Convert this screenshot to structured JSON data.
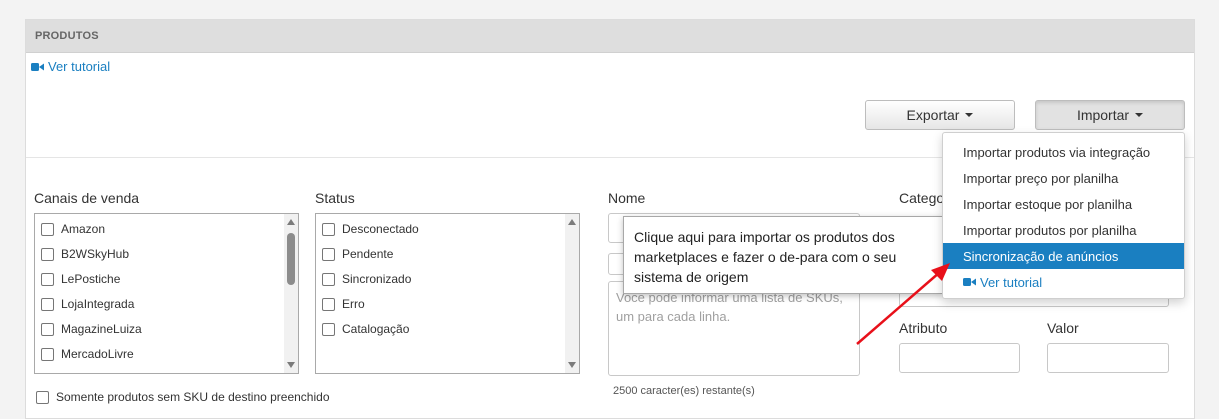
{
  "panel": {
    "title": "PRODUTOS"
  },
  "tutorial": {
    "label": "Ver tutorial"
  },
  "toolbar": {
    "export_label": "Exportar",
    "import_label": "Importar"
  },
  "filters": {
    "channels_label": "Canais de venda",
    "channels": [
      "Amazon",
      "B2WSkyHub",
      "LePostiche",
      "LojaIntegrada",
      "MagazineLuiza",
      "MercadoLivre"
    ],
    "status_label": "Status",
    "statuses": [
      "Desconectado",
      "Pendente",
      "Sincronizado",
      "Erro",
      "Catalogação"
    ],
    "name_label": "Nome",
    "category_label": "Catego",
    "sku_placeholder": "Voce pode informar uma lista de SKUs, um para cada linha.",
    "chars_remaining": "2500 caracter(es) restante(s)",
    "attribute_label": "Atributo",
    "value_label": "Valor",
    "only_without_sku": "Somente produtos sem SKU de destino preenchido"
  },
  "import_menu": {
    "items": [
      "Importar produtos via integração",
      "Importar preço por planilha",
      "Importar estoque por planilha",
      "Importar produtos por planilha",
      "Sincronização de anúncios"
    ],
    "selected": "Sincronização de anúncios",
    "tutorial_label": "Ver tutorial"
  },
  "tooltip": {
    "text": "Clique aqui para importar os produtos dos marketplaces e fazer o de-para com o seu sistema de origem"
  },
  "colors": {
    "accent": "#1a7fc1",
    "arrow": "#e8101a",
    "header_bg": "#dedede"
  }
}
